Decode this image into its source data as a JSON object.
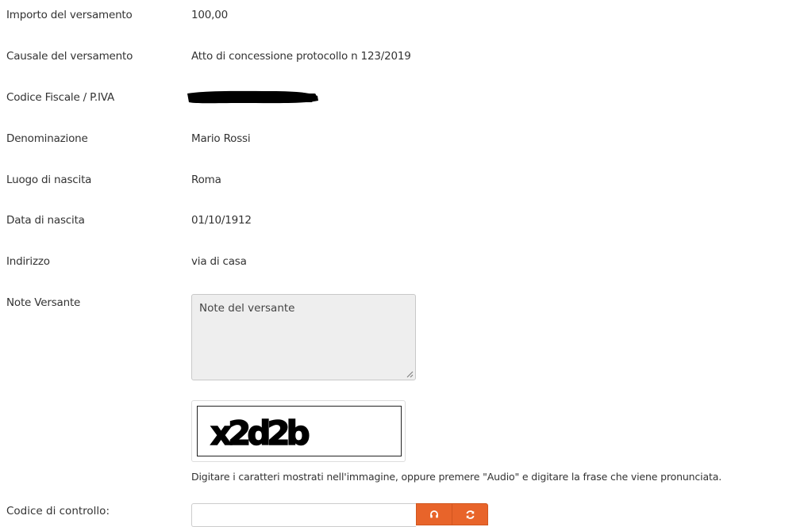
{
  "fields": [
    {
      "label": "Importo del versamento",
      "value": "100,00"
    },
    {
      "label": "Causale del versamento",
      "value": "Atto di concessione protocollo n 123/2019"
    },
    {
      "label": "Codice Fiscale / P.IVA",
      "value": ""
    },
    {
      "label": "Denominazione",
      "value": "Mario Rossi"
    },
    {
      "label": "Luogo di nascita",
      "value": "Roma"
    },
    {
      "label": "Data di nascita",
      "value": "01/10/1912"
    },
    {
      "label": "Indirizzo",
      "value": "via di casa"
    }
  ],
  "notes": {
    "label": "Note Versante",
    "placeholder": "Note del versante"
  },
  "captcha": {
    "text": "x2d2b",
    "help": "Digitare i caratteri mostrati nell'immagine, oppure premere \"Audio\" e digitare la frase che viene pronunciata."
  },
  "control_code": {
    "label": "Codice di controllo:",
    "value": ""
  },
  "icons": {
    "audio": "headphones-icon",
    "refresh": "refresh-icon"
  },
  "colors": {
    "accent": "#e8642a",
    "text": "#333333",
    "redaction": "#000000"
  }
}
